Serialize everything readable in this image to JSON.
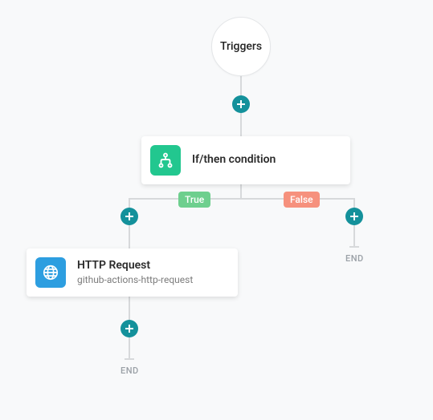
{
  "trigger": {
    "label": "Triggers"
  },
  "condition": {
    "title": "If/then condition"
  },
  "branches": {
    "true_label": "True",
    "false_label": "False"
  },
  "http_node": {
    "title": "HTTP Request",
    "subtitle": "github-actions-http-request"
  },
  "end_label_left": "END",
  "end_label_right": "END",
  "colors": {
    "teal": "#14919b",
    "green_icon": "#22c78f",
    "blue_icon": "#2d9ee0",
    "true_badge": "#6ecf8e",
    "false_badge": "#f6917d"
  }
}
